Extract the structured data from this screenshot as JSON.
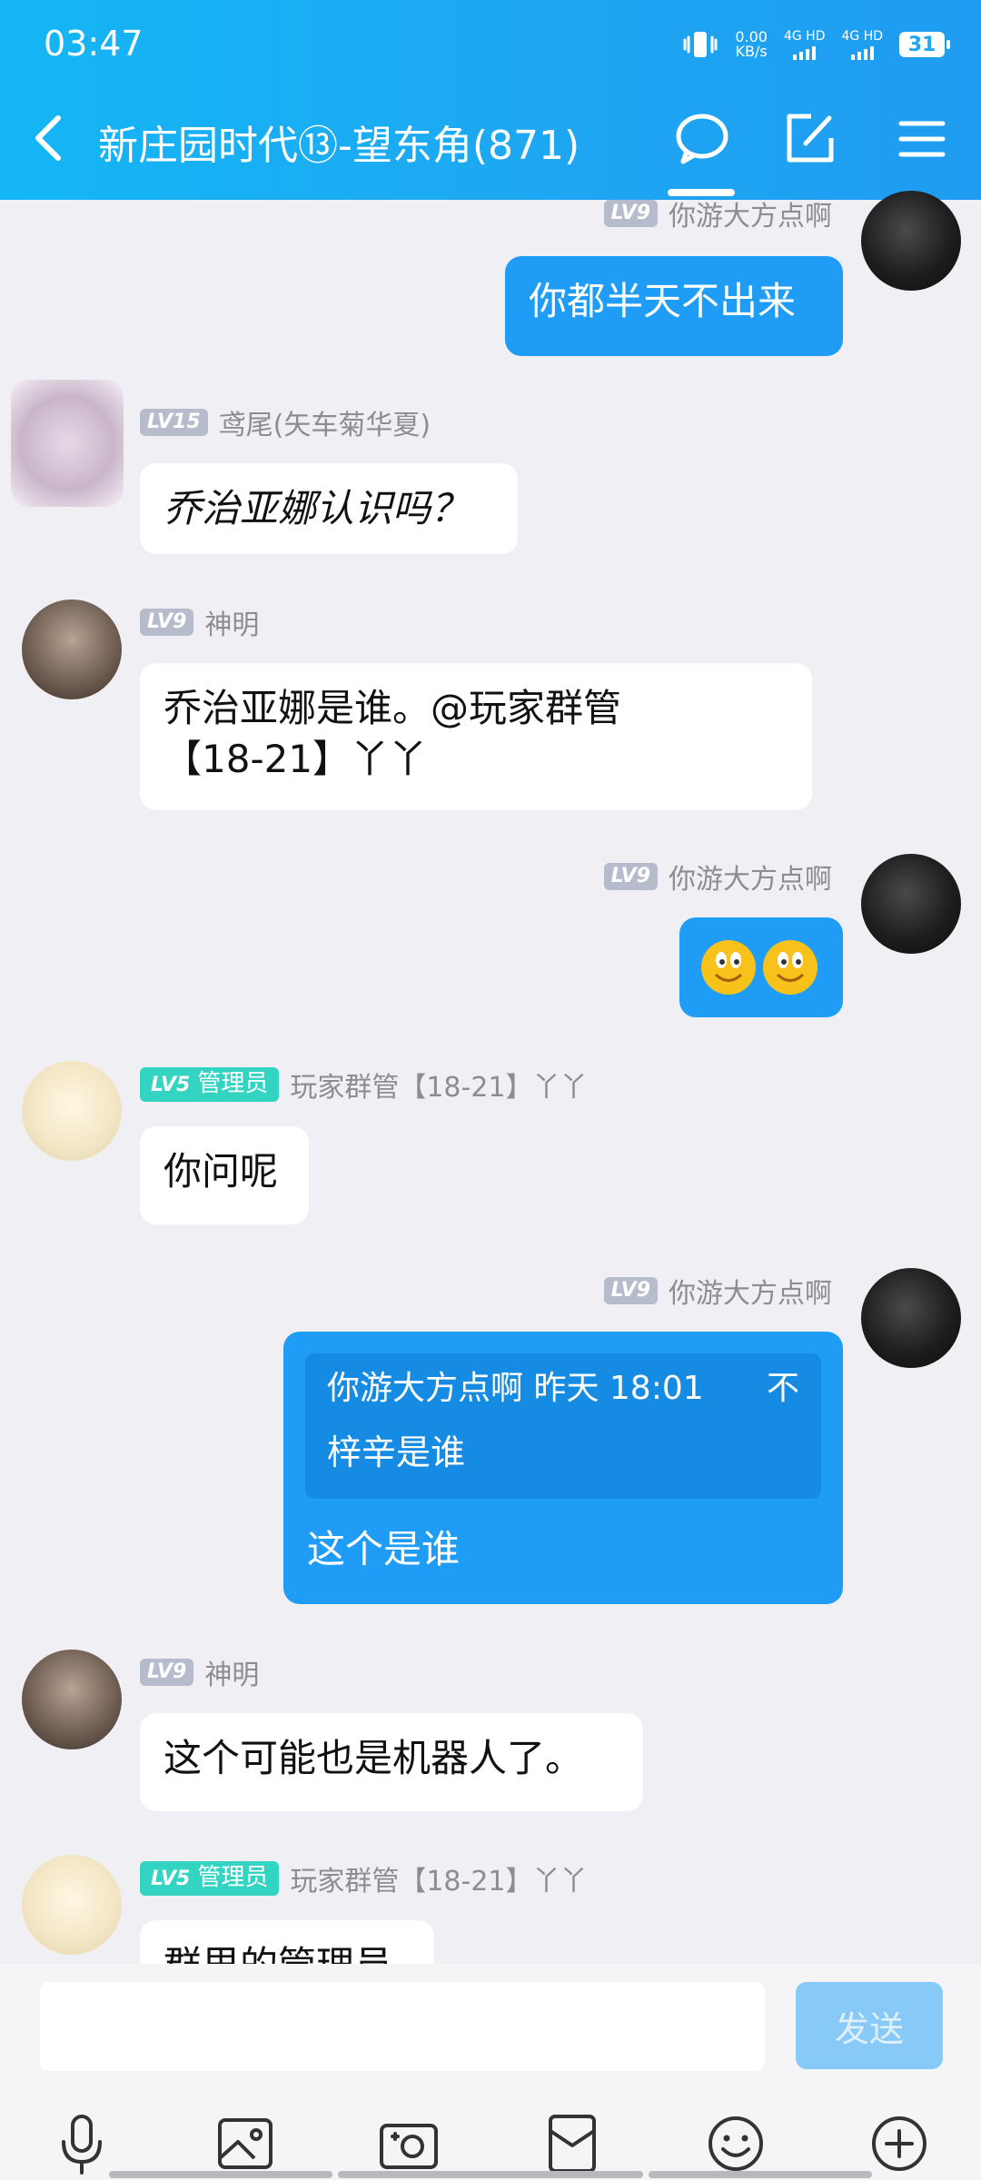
{
  "status": {
    "time": "03:47",
    "speed": "0.00",
    "speed_unit": "KB/s",
    "net1": "4G HD",
    "net2": "4G HD",
    "battery": "31"
  },
  "header": {
    "title": "新庄园时代⑬-望东角(871)"
  },
  "messages": {
    "m1": {
      "level": "LV9",
      "name": "你游大方点啊",
      "text": "你都半天不出来"
    },
    "m2": {
      "level": "LV15",
      "name": "鸢尾(矢车菊华夏)",
      "text": "乔治亚娜认识吗？"
    },
    "m3": {
      "level": "LV9",
      "name": "神明",
      "line1": "乔治亚娜是谁。@玩家群管",
      "line2": "【18-21】丫丫"
    },
    "m4": {
      "level": "LV9",
      "name": "你游大方点啊",
      "emoji": "🙂🙂"
    },
    "m5": {
      "level": "LV5",
      "role": "管理员",
      "name": "玩家群管【18-21】丫丫",
      "text": "你问呢"
    },
    "m6": {
      "level": "LV9",
      "name": "你游大方点啊",
      "quote_header": "你游大方点啊 昨天 18:01",
      "quote_extra": "不",
      "quote_text": "梓辛是谁",
      "text": "这个是谁"
    },
    "m7": {
      "level": "LV9",
      "name": "神明",
      "text": "这个可能也是机器人了。"
    },
    "m8": {
      "level": "LV5",
      "role": "管理员",
      "name": "玩家群管【18-21】丫丫",
      "text": "群里的管理员"
    }
  },
  "input": {
    "placeholder": "",
    "send_label": "发送"
  },
  "icons": {
    "back": "back-arrow-icon",
    "chat": "chat-bubble-icon",
    "edit": "edit-icon",
    "menu": "menu-icon",
    "mic": "mic-icon",
    "image": "image-icon",
    "camera": "camera-icon",
    "redpacket": "red-packet-icon",
    "emoji": "emoji-icon",
    "plus": "plus-icon"
  },
  "colors": {
    "header": "#1ea7f2",
    "bubble_self": "#1e9cf6",
    "admin_badge": "#33d4c2",
    "send_disabled": "#87c9f7"
  }
}
